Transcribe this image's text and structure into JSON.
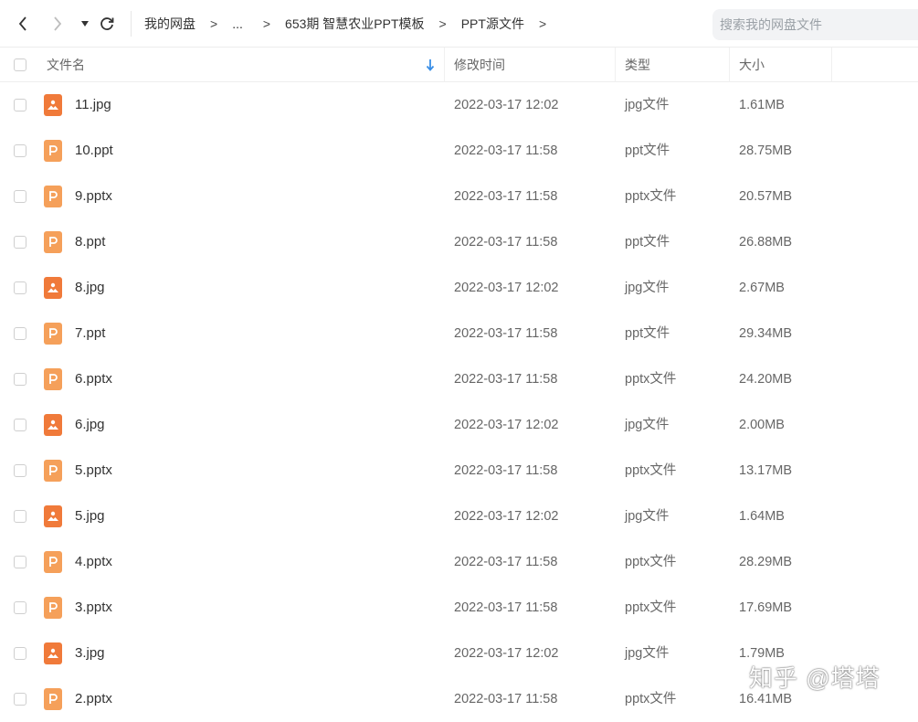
{
  "toolbar": {
    "breadcrumbs": [
      "我的网盘",
      "...",
      "653期 智慧农业PPT模板",
      "PPT源文件"
    ],
    "separator": ">",
    "search_placeholder": "搜索我的网盘文件"
  },
  "columns": {
    "name": "文件名",
    "modified": "修改时间",
    "type": "类型",
    "size": "大小"
  },
  "files": [
    {
      "name": "11.jpg",
      "icon": "image-file-icon",
      "modified": "2022-03-17 12:02",
      "type": "jpg文件",
      "size": "1.61MB"
    },
    {
      "name": "10.ppt",
      "icon": "ppt-file-icon",
      "modified": "2022-03-17 11:58",
      "type": "ppt文件",
      "size": "28.75MB"
    },
    {
      "name": "9.pptx",
      "icon": "ppt-file-icon",
      "modified": "2022-03-17 11:58",
      "type": "pptx文件",
      "size": "20.57MB"
    },
    {
      "name": "8.ppt",
      "icon": "ppt-file-icon",
      "modified": "2022-03-17 11:58",
      "type": "ppt文件",
      "size": "26.88MB"
    },
    {
      "name": "8.jpg",
      "icon": "image-file-icon",
      "modified": "2022-03-17 12:02",
      "type": "jpg文件",
      "size": "2.67MB"
    },
    {
      "name": "7.ppt",
      "icon": "ppt-file-icon",
      "modified": "2022-03-17 11:58",
      "type": "ppt文件",
      "size": "29.34MB"
    },
    {
      "name": "6.pptx",
      "icon": "ppt-file-icon",
      "modified": "2022-03-17 11:58",
      "type": "pptx文件",
      "size": "24.20MB"
    },
    {
      "name": "6.jpg",
      "icon": "image-file-icon",
      "modified": "2022-03-17 12:02",
      "type": "jpg文件",
      "size": "2.00MB"
    },
    {
      "name": "5.pptx",
      "icon": "ppt-file-icon",
      "modified": "2022-03-17 11:58",
      "type": "pptx文件",
      "size": "13.17MB"
    },
    {
      "name": "5.jpg",
      "icon": "image-file-icon",
      "modified": "2022-03-17 12:02",
      "type": "jpg文件",
      "size": "1.64MB"
    },
    {
      "name": "4.pptx",
      "icon": "ppt-file-icon",
      "modified": "2022-03-17 11:58",
      "type": "pptx文件",
      "size": "28.29MB"
    },
    {
      "name": "3.pptx",
      "icon": "ppt-file-icon",
      "modified": "2022-03-17 11:58",
      "type": "pptx文件",
      "size": "17.69MB"
    },
    {
      "name": "3.jpg",
      "icon": "image-file-icon",
      "modified": "2022-03-17 12:02",
      "type": "jpg文件",
      "size": "1.79MB"
    },
    {
      "name": "2.pptx",
      "icon": "ppt-file-icon",
      "modified": "2022-03-17 11:58",
      "type": "pptx文件",
      "size": "16.41MB"
    }
  ],
  "watermark": "知乎 @塔塔",
  "colors": {
    "image_icon": "#f07a3a",
    "ppt_icon": "#f5a05a",
    "sort_arrow": "#3a8ee6"
  }
}
